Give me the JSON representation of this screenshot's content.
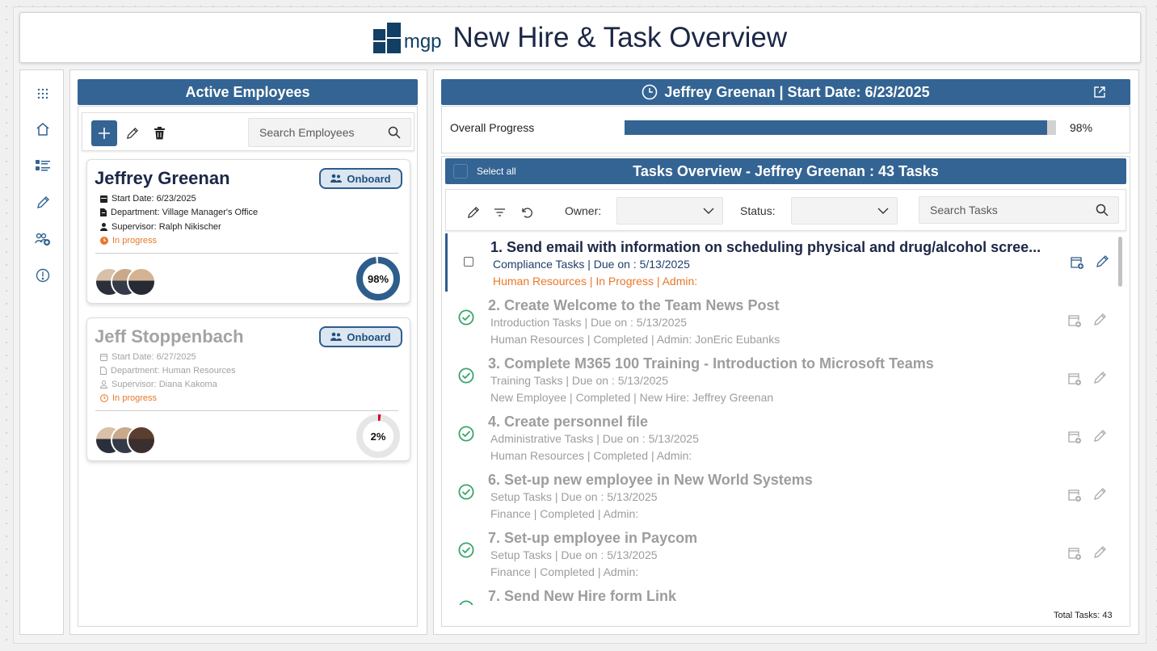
{
  "header": {
    "logo_text": "mgp",
    "title": "New Hire & Task Overview"
  },
  "sidebar": {
    "items": [
      {
        "icon": "grid-icon",
        "name": "apps"
      },
      {
        "icon": "home-icon",
        "name": "home"
      },
      {
        "icon": "list-icon",
        "name": "tasks"
      },
      {
        "icon": "pencil-icon",
        "name": "edit"
      },
      {
        "icon": "add-user-icon",
        "name": "users"
      },
      {
        "icon": "info-icon",
        "name": "alerts"
      }
    ]
  },
  "employees": {
    "title": "Active Employees",
    "search_placeholder": "Search Employees",
    "cards": [
      {
        "name": "Jeffrey Greenan",
        "badge": "Onboard",
        "start_date": "Start Date: 6/23/2025",
        "department": "Department: Village Manager's Office",
        "supervisor": "Supervisor: Ralph Nikischer",
        "status": "In progress",
        "progress": 98,
        "progress_label": "98%"
      },
      {
        "name": "Jeff Stoppenbach",
        "badge": "Onboard",
        "start_date": "Start Date: 6/27/2025",
        "department": "Department: Human Resources",
        "supervisor": "Supervisor: Diana Kakoma",
        "status": "In progress",
        "progress": 2,
        "progress_label": "2%"
      }
    ]
  },
  "detail": {
    "header": "Jeffrey Greenan |  Start Date: 6/23/2025",
    "progress_label": "Overall Progress",
    "progress_value": 98,
    "progress_text": "98%"
  },
  "tasks": {
    "select_all": "Select all",
    "title": "Tasks Overview - Jeffrey Greenan : 43 Tasks",
    "owner_label": "Owner:",
    "status_label": "Status:",
    "owner_value": "",
    "status_value": "",
    "search_placeholder": "Search Tasks",
    "total": "Total Tasks: 43",
    "items": [
      {
        "title": "1. Send email with information on scheduling physical and drug/alcohol scree...",
        "line2": "Compliance Tasks | Due on : 5/13/2025",
        "line3": "Human Resources | In Progress | Admin:",
        "completed": false,
        "active": true
      },
      {
        "title": "2. Create Welcome to the Team News Post",
        "line2": "Introduction Tasks | Due on : 5/13/2025",
        "line3": "Human Resources | Completed | Admin: JonEric Eubanks",
        "completed": true,
        "active": false
      },
      {
        "title": "3. Complete M365 100 Training - Introduction to Microsoft Teams",
        "line2": "Training Tasks | Due on : 5/13/2025",
        "line3": "New Employee | Completed |  New Hire: Jeffrey Greenan",
        "completed": true,
        "active": false
      },
      {
        "title": "4. Create personnel file",
        "line2": "Administrative Tasks | Due on : 5/13/2025",
        "line3": "Human Resources | Completed | Admin:",
        "completed": true,
        "active": false
      },
      {
        "title": "6. Set-up new employee in New World Systems",
        "line2": "Setup Tasks | Due on : 5/13/2025",
        "line3": "Finance | Completed | Admin:",
        "completed": true,
        "active": false
      },
      {
        "title": "7. Set-up employee in Paycom",
        "line2": "Setup Tasks | Due on : 5/13/2025",
        "line3": "Finance | Completed | Admin:",
        "completed": true,
        "active": false
      },
      {
        "title": "7. Send New Hire form Link",
        "line2": "",
        "line3": "",
        "completed": true,
        "active": false
      }
    ]
  },
  "colors": {
    "primary": "#336493",
    "accent_orange": "#e8782a",
    "check_green": "#3aa56a",
    "danger_red": "#d0021b"
  }
}
